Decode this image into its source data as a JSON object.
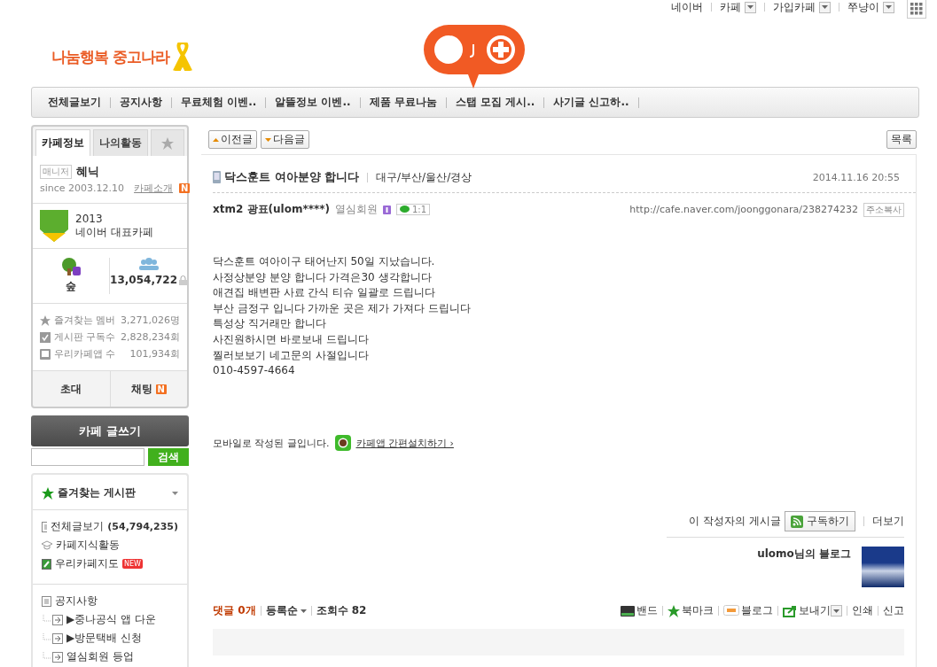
{
  "top_links": [
    {
      "label": "네이버",
      "dropdown": false
    },
    {
      "label": "카페",
      "dropdown": true
    },
    {
      "label": "가입카페",
      "dropdown": true
    },
    {
      "label": "쭈냥이",
      "dropdown": true
    }
  ],
  "cafe_name": "나눔행복 중고나라",
  "menu": [
    "전체글보기",
    "공지사항",
    "무료체험 이벤..",
    "알뜰정보 이벤..",
    "제품 무료나눔",
    "스탭 모집 게시..",
    "사기글 신고하.."
  ],
  "sidebar": {
    "tabs": [
      {
        "label": "카페정보",
        "selected": true
      },
      {
        "label": "나의활동",
        "selected": false
      }
    ],
    "manager_badge": "매니저",
    "manager": "혜닉",
    "since": "since 2003.12.10",
    "intro_link": "카페소개",
    "intro_new": "N",
    "award_year": "2013",
    "award_title": "네이버 대표카페",
    "rank": "숲",
    "members": "13,054,722",
    "stats": [
      {
        "kind": "star",
        "label": "즐겨찾는 멤버",
        "value": "3,271,026명"
      },
      {
        "kind": "check",
        "label": "게시판 구독수",
        "value": "2,828,234회"
      },
      {
        "kind": "phone",
        "label": "우리카페앱 수",
        "value": "101,934회"
      }
    ],
    "invite": "초대",
    "chat": "채팅",
    "chat_new": "N",
    "write_button": "카페 글쓰기",
    "search_button": "검색",
    "favorites_title": "즐겨찾는 게시판",
    "favorites": [
      {
        "kind": "list",
        "label": "전체글보기",
        "count": "(54,794,235)"
      },
      {
        "kind": "cap",
        "label": "카페지식활동"
      },
      {
        "kind": "map",
        "label": "우리카페지도",
        "badge": "NEW"
      }
    ],
    "boards": [
      {
        "label": "공지사항",
        "children": [
          {
            "label": "▶중나공식 앱 다운"
          },
          {
            "label": "▶방문택배 신청"
          },
          {
            "label": "열심회원 등업"
          }
        ]
      }
    ]
  },
  "nav": {
    "prev": "이전글",
    "next": "다음글",
    "list": "목록"
  },
  "post": {
    "title": "닥스훈트 여아분양 합니다",
    "category": "대구/부산/울산/경상",
    "date": "2014.11.16 20:55",
    "author": "xtm2 광표(ulom****)",
    "grade": "열심회원",
    "chat_button": "1:1",
    "url": "http://cafe.naver.com/joonggonara/238274232",
    "copy_button": "주소복사",
    "body": [
      "닥스훈트 여아이구 태어난지 50일 지났습니다.",
      "사정상분양 분양 합니다 가격은30 생각합니다",
      "애견집 배변판 사료 간식 티슈 일괄로 드립니다",
      "부산 금정구 입니다 가까운 곳은 제가 가져다 드립니다",
      "특성상 직거래만 합니다",
      "사진원하시면 바로보내 드립니다",
      "찔러보보기 네고문의 사절입니다",
      "010-4597-4664"
    ],
    "mobile_note": "모바일로 작성된 글입니다.",
    "app_link": "카페앱 간편설치하기 ›",
    "author_posts": "이 작성자의 게시글",
    "subscribe": "구독하기",
    "more": "더보기",
    "blog": "ulomo님의 블로그"
  },
  "footer": {
    "comments": "댓글 0개",
    "sort": "등록순",
    "views": "조회수 82",
    "actions": [
      {
        "kind": "band",
        "label": "밴드",
        "dropdown": false
      },
      {
        "kind": "bookmark",
        "label": "북마크",
        "dropdown": false
      },
      {
        "kind": "blog",
        "label": "블로그",
        "dropdown": false
      },
      {
        "kind": "send",
        "label": "보내기",
        "dropdown": true
      },
      {
        "kind": "none",
        "label": "인쇄",
        "dropdown": false
      },
      {
        "kind": "none",
        "label": "신고",
        "dropdown": false
      }
    ]
  }
}
